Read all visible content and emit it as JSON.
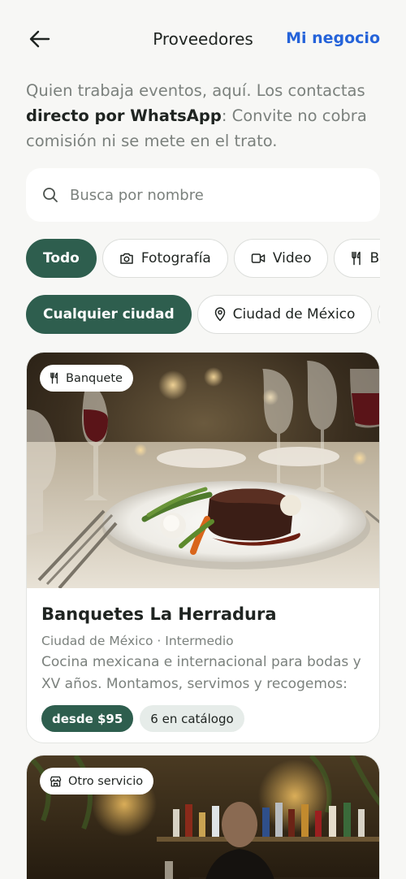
{
  "header": {
    "title": "Proveedores",
    "right_link": "Mi negocio"
  },
  "intro": {
    "text_before": "Quien trabaja eventos, aquí. Los contactas ",
    "bold": "directo por WhatsApp",
    "text_after": ": Convite no cobra comisión ni se mete en el trato."
  },
  "search": {
    "placeholder": "Busca por nombre",
    "value": ""
  },
  "categories": [
    {
      "label": "Todo",
      "icon": null,
      "active": true
    },
    {
      "label": "Fotografía",
      "icon": "camera-icon",
      "active": false
    },
    {
      "label": "Video",
      "icon": "video-icon",
      "active": false
    },
    {
      "label": "Banquete",
      "icon": "fork-knife-icon",
      "active": false
    }
  ],
  "cities": [
    {
      "label": "Cualquier ciudad",
      "icon": null,
      "active": true
    },
    {
      "label": "Ciudad de México",
      "icon": "location-pin-icon",
      "active": false
    },
    {
      "label": "",
      "icon": "location-pin-icon",
      "active": false
    }
  ],
  "listings": [
    {
      "badge": "Banquete",
      "badge_icon": "fork-knife-icon",
      "name": "Banquetes La Herradura",
      "meta": "Ciudad de México · Intermedio",
      "description": "Cocina mexicana e internacional para bodas y XV años. Montamos, servimos y recogemos: tú no ...",
      "price": "desde $95",
      "catalog": "6 en catálogo"
    },
    {
      "badge": "Otro servicio",
      "badge_icon": "store-icon"
    }
  ],
  "colors": {
    "accent_green": "#2e5e4e",
    "link_blue": "#2563d9",
    "background": "#f7f7f5"
  }
}
